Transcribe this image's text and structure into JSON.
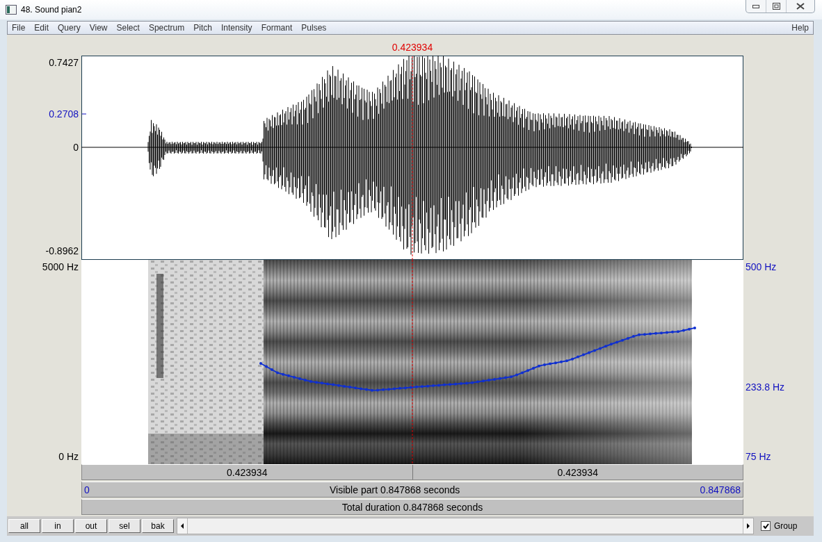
{
  "window": {
    "title": "48. Sound pian2"
  },
  "menu": {
    "items": [
      "File",
      "Edit",
      "Query",
      "View",
      "Select",
      "Spectrum",
      "Pitch",
      "Intensity",
      "Formant",
      "Pulses"
    ],
    "help": "Help"
  },
  "cursor": {
    "time": "0.423934"
  },
  "waveform": {
    "y_max": "0.7427",
    "y_mark": "0.2708",
    "y_zero": "0",
    "y_min": "-0.8962"
  },
  "spectrogram": {
    "freq_max": "5000 Hz",
    "freq_min": "0 Hz",
    "pitch_max": "500 Hz",
    "pitch_value": "233.8 Hz",
    "pitch_min": "75 Hz"
  },
  "time_bars": {
    "left_part": "0.423934",
    "right_part": "0.423934",
    "visible_start": "0",
    "visible_label": "Visible part 0.847868 seconds",
    "visible_end": "0.847868",
    "total": "Total duration 0.847868 seconds"
  },
  "buttons": [
    "all",
    "in",
    "out",
    "sel",
    "bak"
  ],
  "group": {
    "label": "Group",
    "checked": true
  }
}
